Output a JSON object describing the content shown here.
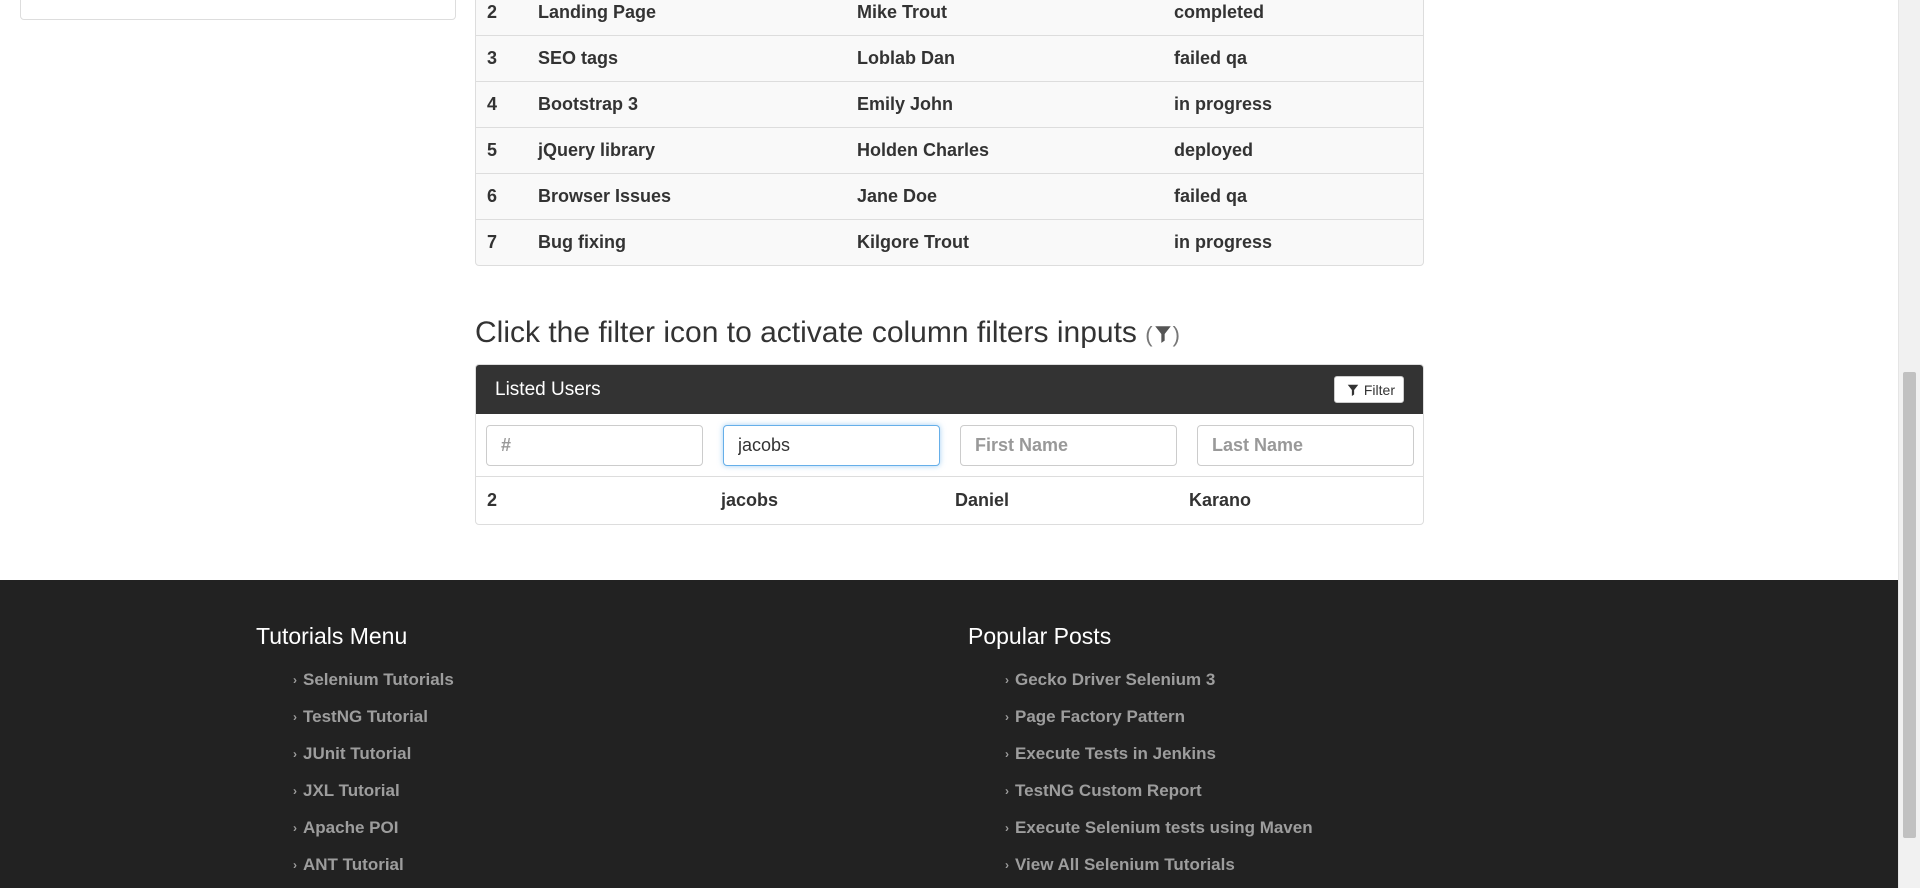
{
  "tasks_table": {
    "rows": [
      {
        "id": "2",
        "task": "Landing Page",
        "assignee": "Mike Trout",
        "status": "completed"
      },
      {
        "id": "3",
        "task": "SEO tags",
        "assignee": "Loblab Dan",
        "status": "failed qa"
      },
      {
        "id": "4",
        "task": "Bootstrap 3",
        "assignee": "Emily John",
        "status": "in progress"
      },
      {
        "id": "5",
        "task": "jQuery library",
        "assignee": "Holden Charles",
        "status": "deployed"
      },
      {
        "id": "6",
        "task": "Browser Issues",
        "assignee": "Jane Doe",
        "status": "failed qa"
      },
      {
        "id": "7",
        "task": "Bug fixing",
        "assignee": "Kilgore Trout",
        "status": "in progress"
      }
    ]
  },
  "filter_section": {
    "heading": "Click the filter icon to activate column filters inputs",
    "paren_open": "(",
    "paren_close": ")"
  },
  "users_panel": {
    "title": "Listed Users",
    "filter_button_label": "Filter",
    "filters": {
      "id_placeholder": "#",
      "username_value": "jacobs",
      "first_name_placeholder": "First Name",
      "last_name_placeholder": "Last Name"
    },
    "results": [
      {
        "id": "2",
        "username": "jacobs",
        "first_name": "Daniel",
        "last_name": "Karano"
      }
    ]
  },
  "footer": {
    "tutorials_heading": "Tutorials Menu",
    "tutorials": [
      "Selenium Tutorials",
      "TestNG Tutorial",
      "JUnit Tutorial",
      "JXL Tutorial",
      "Apache POI",
      "ANT Tutorial"
    ],
    "posts_heading": "Popular Posts",
    "posts": [
      "Gecko Driver Selenium 3",
      "Page Factory Pattern",
      "Execute Tests in Jenkins",
      "TestNG Custom Report",
      "Execute Selenium tests using Maven",
      "View All Selenium Tutorials"
    ],
    "chevron": "›"
  },
  "colors": {
    "panel_header": "#333333",
    "footer_bg": "#222222",
    "footer_link": "#9d9d9d",
    "focus_border": "#66afe9"
  },
  "icons": {
    "filter": "funnel-icon",
    "chevron": "chevron-right-icon"
  }
}
